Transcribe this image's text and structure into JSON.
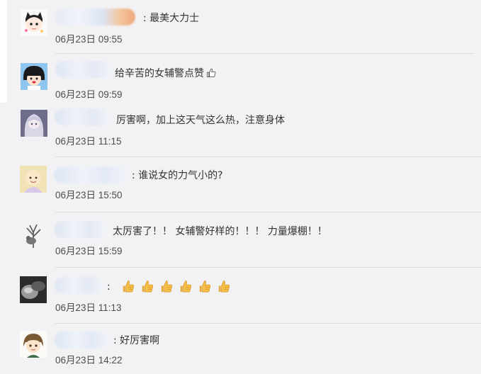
{
  "comments": [
    {
      "text": ":   最美大力士",
      "time": "06月23日 09:55"
    },
    {
      "text": "给辛苦的女辅警点赞",
      "time": "06月23日 09:59"
    },
    {
      "text": "厉害啊，加上这天气这么热，注意身体",
      "time": "06月23日 11:15"
    },
    {
      "text": ":   谁说女的力气小的?",
      "time": "06月23日 15:50"
    },
    {
      "text": "太厉害了！！ 女辅警好样的！！！ 力量爆棚！！",
      "time": "06月23日 15:59"
    },
    {
      "text": ":",
      "time": "06月23日 11:13",
      "thumbs_count": 6
    },
    {
      "text": ":   好厉害啊",
      "time": "06月23日 14:22"
    }
  ],
  "icons": {
    "thumbs_up": "thumbs-up-icon"
  }
}
